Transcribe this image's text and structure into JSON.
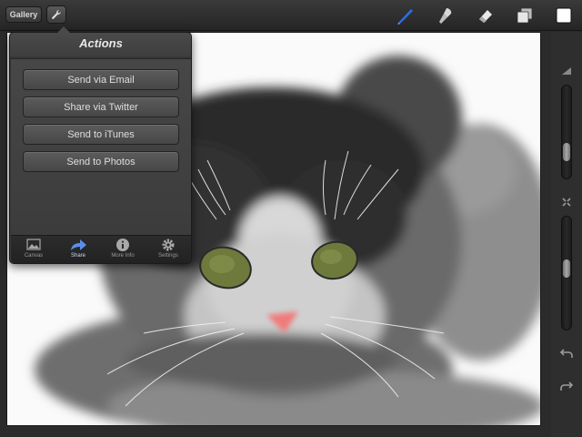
{
  "toolbar": {
    "gallery_label": "Gallery",
    "tools": [
      {
        "icon": "brush-icon",
        "color": "#2f6fe0"
      },
      {
        "icon": "smudge-icon"
      },
      {
        "icon": "eraser-icon"
      },
      {
        "icon": "layers-icon"
      },
      {
        "icon": "color-swatch-icon",
        "color": "#ffffff"
      }
    ]
  },
  "actions_popover": {
    "title": "Actions",
    "buttons": [
      {
        "label": "Send via Email"
      },
      {
        "label": "Share via Twitter"
      },
      {
        "label": "Send to iTunes"
      },
      {
        "label": "Send to Photos"
      }
    ],
    "tabs": [
      {
        "label": "Canvas",
        "icon": "image-icon"
      },
      {
        "label": "Share",
        "icon": "share-arrow-icon",
        "active": true
      },
      {
        "label": "More Info",
        "icon": "info-icon"
      },
      {
        "label": "Settings",
        "icon": "gear-icon"
      }
    ]
  },
  "sidebar": {
    "brush_size_level": 0.22,
    "opacity_level": 0.55,
    "icons": [
      "triangle-up-icon",
      "swap-icon",
      "undo-icon",
      "redo-icon"
    ]
  }
}
